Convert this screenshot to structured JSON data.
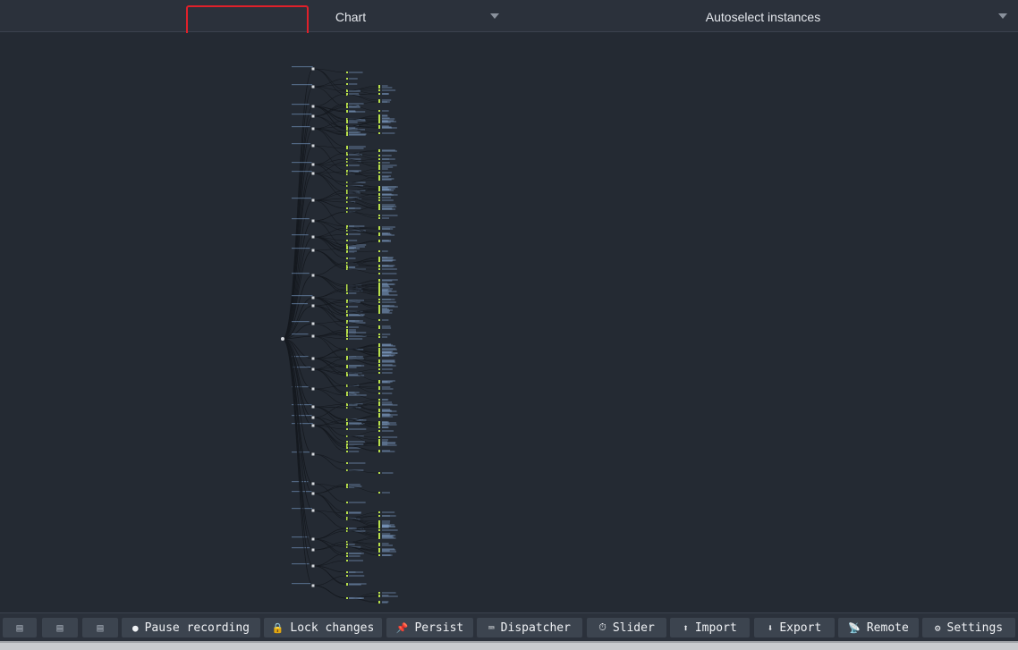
{
  "header": {
    "monitor_label": "Chart",
    "instance_label": "Autoselect instances"
  },
  "toolbar": {
    "buttons": [
      {
        "id": "pause",
        "icon": "record-circle-icon",
        "glyph": "●",
        "label": "Pause recording"
      },
      {
        "id": "lock",
        "icon": "lock-icon",
        "glyph": "🔒",
        "label": "Lock changes"
      },
      {
        "id": "persist",
        "icon": "pin-icon",
        "glyph": "📌",
        "label": "Persist"
      },
      {
        "id": "dispatcher",
        "icon": "keyboard-icon",
        "glyph": "⌨",
        "label": "Dispatcher"
      },
      {
        "id": "slider",
        "icon": "timer-icon",
        "glyph": "⏱",
        "label": "Slider"
      },
      {
        "id": "import",
        "icon": "upload-icon",
        "glyph": "⬆",
        "label": "Import"
      },
      {
        "id": "export",
        "icon": "download-icon",
        "glyph": "⬇",
        "label": "Export"
      },
      {
        "id": "remote",
        "icon": "antenna-icon",
        "glyph": "📡",
        "label": "Remote"
      },
      {
        "id": "settings",
        "icon": "gear-icon",
        "glyph": "⚙",
        "label": "Settings"
      }
    ],
    "layout_buttons": [
      {
        "icon": "layout-left-icon",
        "glyph": "▤"
      },
      {
        "icon": "layout-bottom-icon",
        "glyph": "▤"
      },
      {
        "icon": "layout-right-icon",
        "glyph": "▤"
      }
    ]
  },
  "colors": {
    "background": "#242a33",
    "panel": "#2b313b",
    "button": "#3c444f",
    "highlight": "#e0202a",
    "leaf_node": "#b8e04a",
    "link": "#15191f"
  }
}
